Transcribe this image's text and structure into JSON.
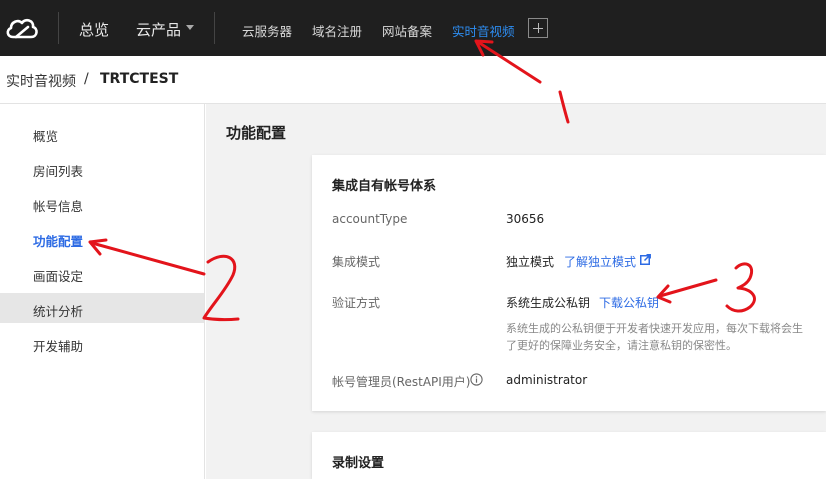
{
  "topnav": {
    "overview": "总览",
    "products": "云产品",
    "items": [
      "云服务器",
      "域名注册",
      "网站备案",
      "实时音视频"
    ]
  },
  "breadcrumb": {
    "parent": "实时音视频",
    "separator": "/",
    "current": "TRTCTEST"
  },
  "sidebar": {
    "items": [
      {
        "label": "概览"
      },
      {
        "label": "房间列表"
      },
      {
        "label": "帐号信息"
      },
      {
        "label": "功能配置"
      },
      {
        "label": "画面设定"
      },
      {
        "label": "统计分析"
      },
      {
        "label": "开发辅助"
      }
    ]
  },
  "content": {
    "title": "功能配置",
    "account_card": {
      "title": "集成自有帐号体系",
      "account_type_label": "accountType",
      "account_type_value": "30656",
      "mode_label": "集成模式",
      "mode_value": "独立模式",
      "mode_link": "了解独立模式",
      "verify_label": "验证方式",
      "verify_value": "系统生成公私钥",
      "verify_link": "下载公私钥",
      "verify_hint_1": "系统生成的公私钥便于开发者快速开发应用，每次下载将会生",
      "verify_hint_2": "了更好的保障业务安全，请注意私钥的保密性。",
      "admin_label": "帐号管理员(RestAPI用户)",
      "admin_value": "administrator"
    },
    "record_card": {
      "title": "录制设置"
    }
  },
  "annotations": {
    "marks": [
      "1",
      "2",
      "3"
    ],
    "color": "#e3141b"
  },
  "colors": {
    "topbar": "#1f1f1f",
    "accent": "#2d8cf0",
    "link": "#2d6be4",
    "content_bg": "#f2f2f2"
  }
}
